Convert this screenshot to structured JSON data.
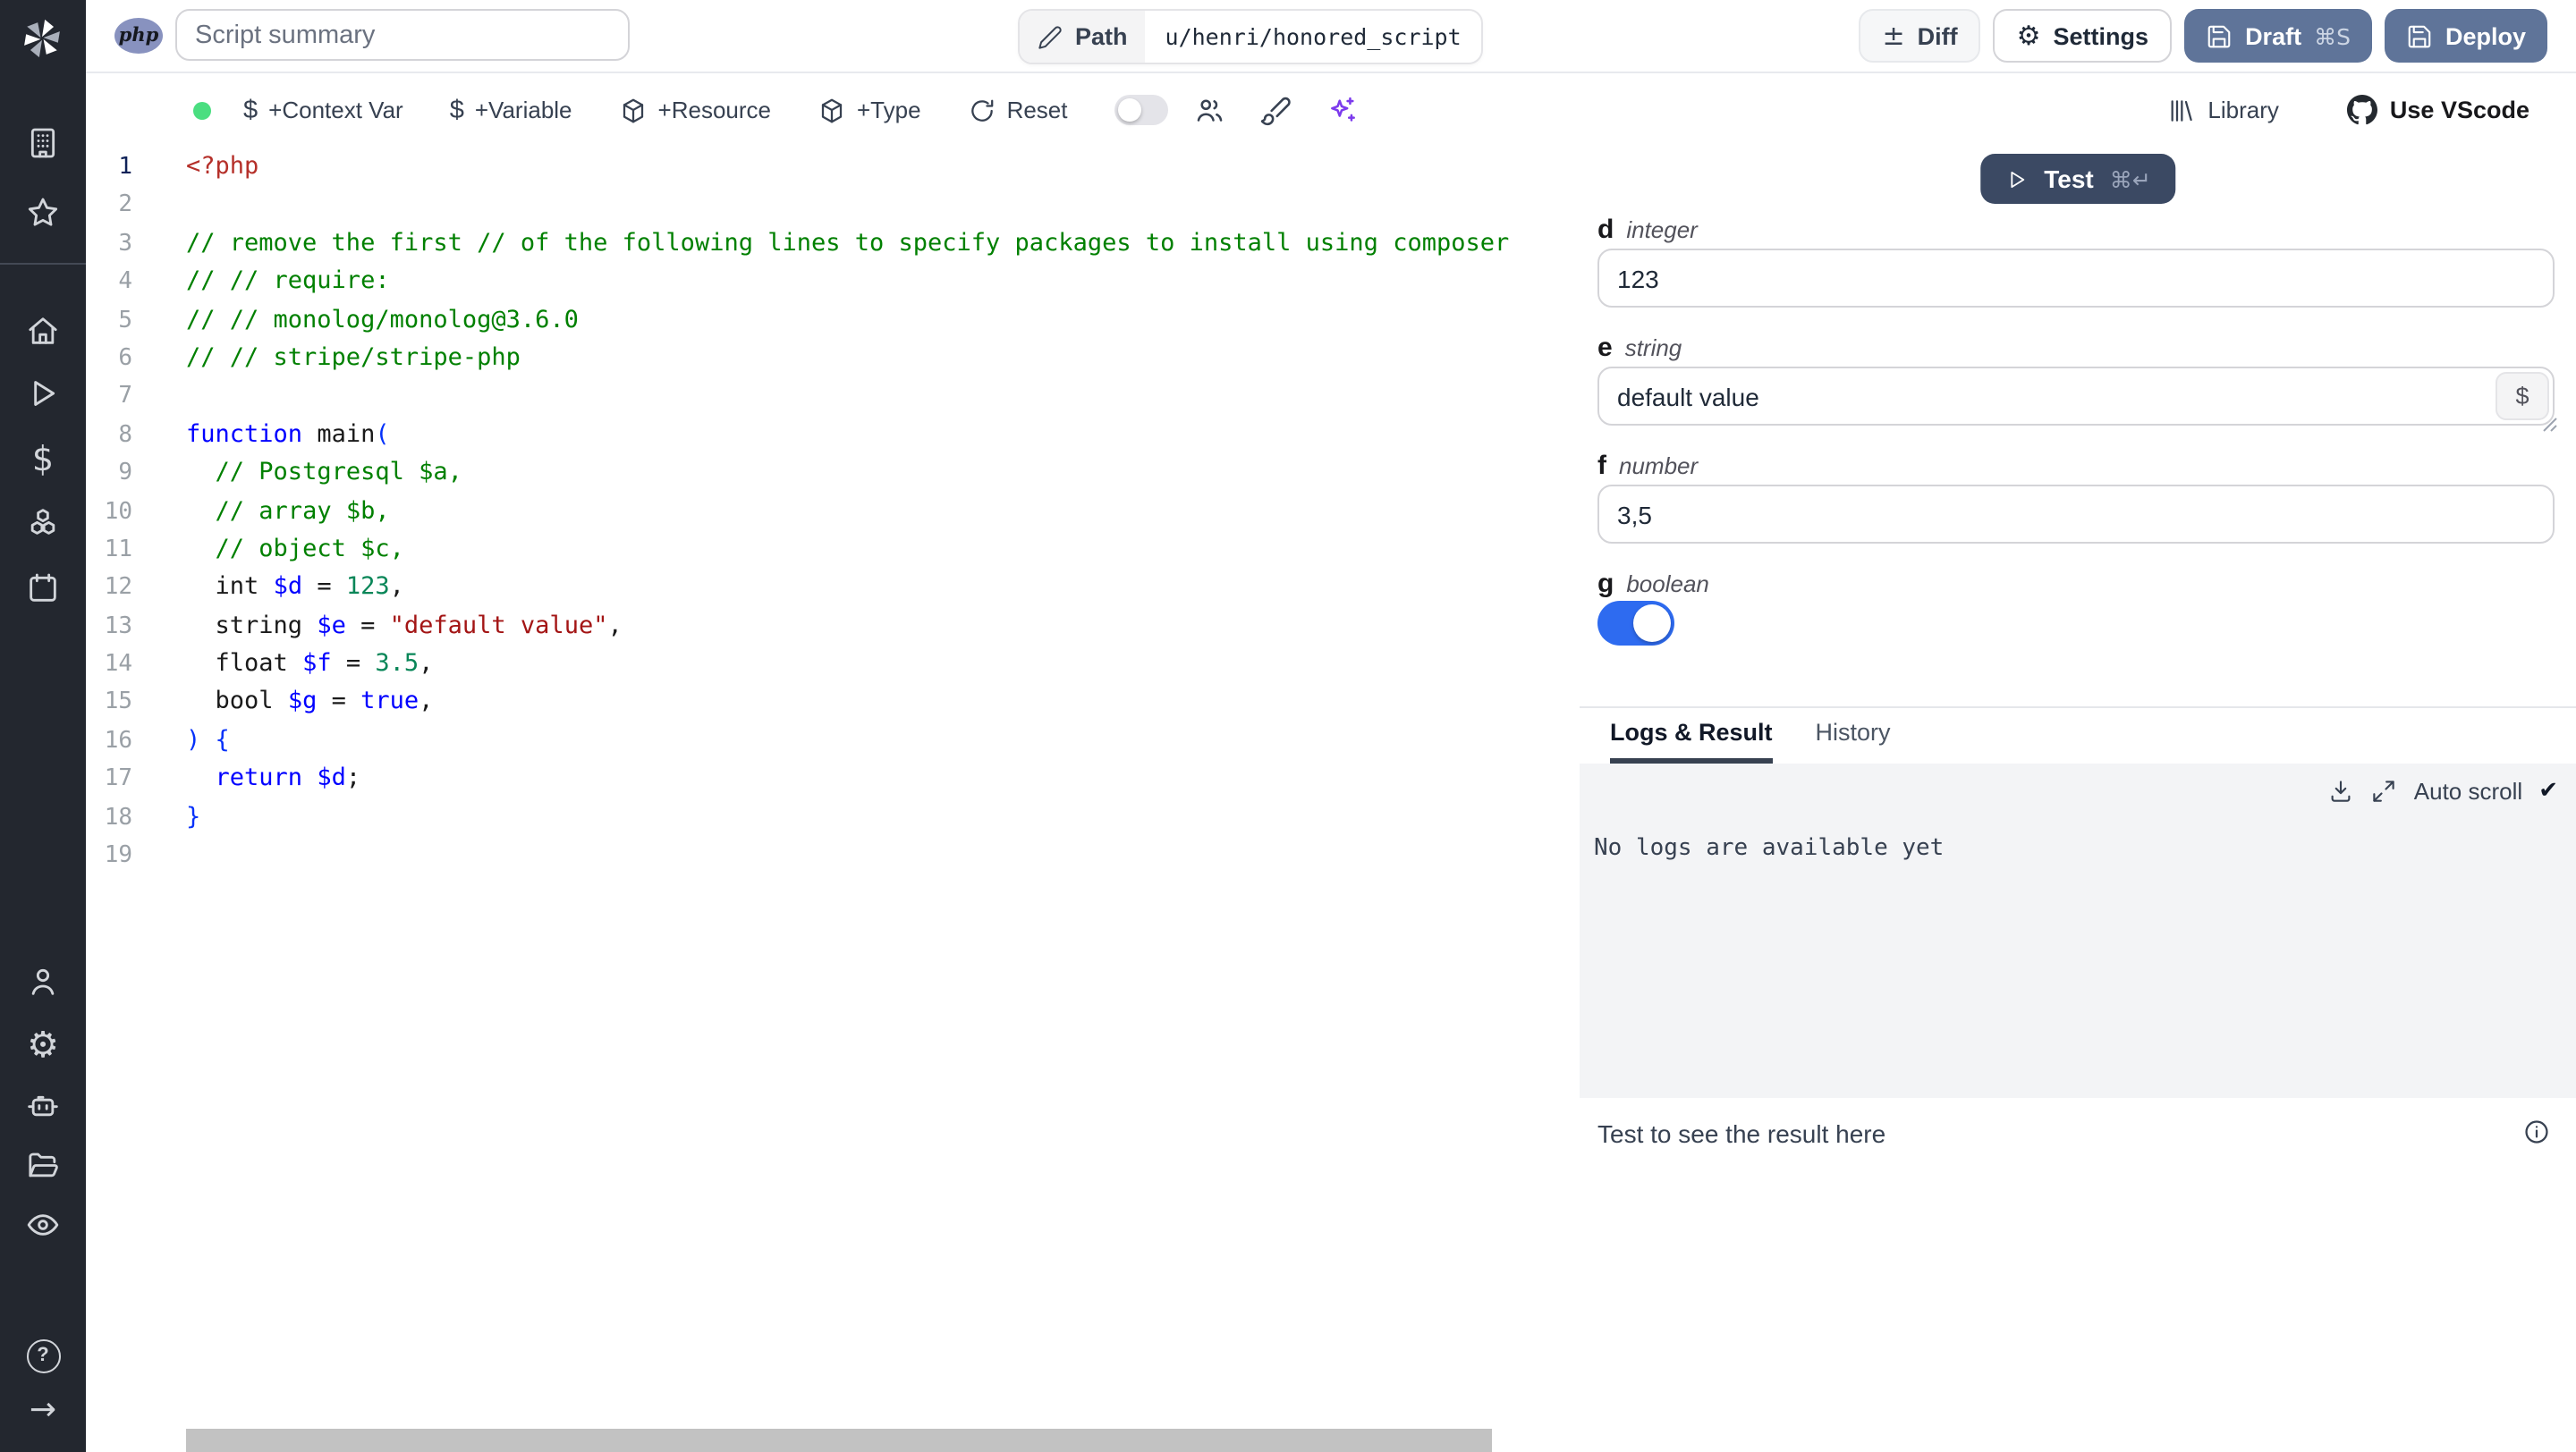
{
  "topbar": {
    "language_badge": "php",
    "summary_placeholder": "Script summary",
    "path_label": "Path",
    "path_value": "u/henri/honored_script",
    "diff_label": "Diff",
    "diff_icon_glyph": "±",
    "settings_label": "Settings",
    "draft_label": "Draft",
    "draft_shortcut": "⌘S",
    "deploy_label": "Deploy"
  },
  "toolbar": {
    "status_dot_color": "#4ade80",
    "context_var_label": "+Context Var",
    "variable_label": "+Variable",
    "resource_label": "+Resource",
    "type_label": "+Type",
    "reset_label": "Reset",
    "dollar_icon_glyph": "$",
    "assistant_toggle_on": false,
    "library_label": "Library",
    "vscode_label": "Use VScode",
    "sparkles_color": "#7c3aed"
  },
  "sidebar": {
    "icon_names": [
      "windmill-logo",
      "building",
      "star",
      "home",
      "play",
      "dollar",
      "cubes",
      "calendar",
      "user",
      "gear",
      "robot",
      "folder",
      "eye",
      "help-circle",
      "arrow-right"
    ],
    "dollar_glyph": "$",
    "gear_glyph": "⚙",
    "arrow_glyph": "→",
    "help_glyph": "?"
  },
  "editor": {
    "active_line": 1,
    "lines": [
      {
        "n": 1,
        "t": [
          [
            "tag",
            "<?php"
          ]
        ]
      },
      {
        "n": 2,
        "t": []
      },
      {
        "n": 3,
        "t": [
          [
            "comment",
            "// remove the first // of the following lines to specify packages to install using composer"
          ]
        ]
      },
      {
        "n": 4,
        "t": [
          [
            "comment",
            "// // require:"
          ]
        ]
      },
      {
        "n": 5,
        "t": [
          [
            "comment",
            "// // monolog/monolog@3.6.0"
          ]
        ]
      },
      {
        "n": 6,
        "t": [
          [
            "comment",
            "// // stripe/stripe-php"
          ]
        ]
      },
      {
        "n": 7,
        "t": []
      },
      {
        "n": 8,
        "t": [
          [
            "kw",
            "function"
          ],
          [
            "plain",
            " main"
          ],
          [
            "br",
            "("
          ]
        ]
      },
      {
        "n": 9,
        "t": [
          [
            "plain",
            "  "
          ],
          [
            "comment",
            "// Postgresql $a,"
          ]
        ]
      },
      {
        "n": 10,
        "t": [
          [
            "plain",
            "  "
          ],
          [
            "comment",
            "// array $b,"
          ]
        ]
      },
      {
        "n": 11,
        "t": [
          [
            "plain",
            "  "
          ],
          [
            "comment",
            "// object $c,"
          ]
        ]
      },
      {
        "n": 12,
        "t": [
          [
            "plain",
            "  int "
          ],
          [
            "var",
            "$d"
          ],
          [
            "plain",
            " = "
          ],
          [
            "num",
            "123"
          ],
          [
            "plain",
            ","
          ]
        ]
      },
      {
        "n": 13,
        "t": [
          [
            "plain",
            "  string "
          ],
          [
            "var",
            "$e"
          ],
          [
            "plain",
            " = "
          ],
          [
            "str",
            "\"default value\""
          ],
          [
            "plain",
            ","
          ]
        ]
      },
      {
        "n": 14,
        "t": [
          [
            "plain",
            "  float "
          ],
          [
            "var",
            "$f"
          ],
          [
            "plain",
            " = "
          ],
          [
            "num",
            "3.5"
          ],
          [
            "plain",
            ","
          ]
        ]
      },
      {
        "n": 15,
        "t": [
          [
            "plain",
            "  bool "
          ],
          [
            "var",
            "$g"
          ],
          [
            "plain",
            " = "
          ],
          [
            "kw",
            "true"
          ],
          [
            "plain",
            ","
          ]
        ]
      },
      {
        "n": 16,
        "t": [
          [
            "br",
            ") {"
          ]
        ]
      },
      {
        "n": 17,
        "t": [
          [
            "plain",
            "  "
          ],
          [
            "kw",
            "return"
          ],
          [
            "plain",
            " "
          ],
          [
            "var",
            "$d"
          ],
          [
            "plain",
            ";"
          ]
        ]
      },
      {
        "n": 18,
        "t": [
          [
            "br",
            "}"
          ]
        ]
      },
      {
        "n": 19,
        "t": []
      }
    ]
  },
  "panel": {
    "test": {
      "label": "Test",
      "shortcut": "⌘↵",
      "color": "#3b4963"
    },
    "fields": {
      "d": {
        "name": "d",
        "type": "integer",
        "value": "123"
      },
      "e": {
        "name": "e",
        "type": "string",
        "value": "default value",
        "picker_glyph": "$"
      },
      "f": {
        "name": "f",
        "type": "number",
        "value": "3,5"
      },
      "g": {
        "name": "g",
        "type": "boolean",
        "value": true,
        "toggle_color": "#2e6bf0"
      }
    },
    "logs": {
      "tabs": [
        "Logs & Result",
        "History"
      ],
      "active_tab": "Logs & Result",
      "auto_scroll_label": "Auto scroll",
      "auto_scroll_checked": true,
      "check_glyph": "✔",
      "empty_message": "No logs are available yet"
    },
    "result": {
      "placeholder": "Test to see the result here"
    }
  },
  "colors": {
    "sidebar_bg": "#23272f",
    "slate_button": "#5f7499",
    "border": "#e8eaee",
    "logs_bg": "#f3f4f6",
    "php_badge": "#8892bf"
  }
}
